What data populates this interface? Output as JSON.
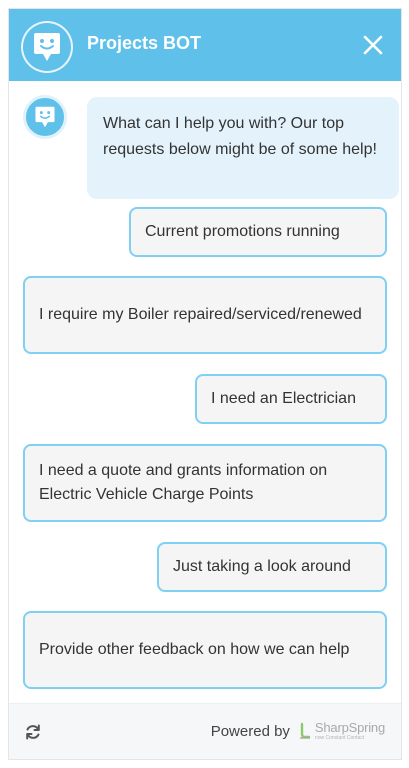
{
  "header": {
    "title": "Projects BOT",
    "brand_color": "#5fc0ea"
  },
  "chat": {
    "bot_message": "What can I help you with? Our top requests below might be of some help!"
  },
  "options": [
    {
      "label": "Current promotions running"
    },
    {
      "label": "I require my Boiler repaired/serviced/renewed"
    },
    {
      "label": "I need an Electrician"
    },
    {
      "label": "I need a quote and grants information on Electric Vehicle Charge Points"
    },
    {
      "label": "Just taking a look around"
    },
    {
      "label": "Provide other feedback on how we can help"
    }
  ],
  "footer": {
    "powered_by": "Powered by",
    "brand_name": "SharpSpring",
    "brand_sub": "now Constant Contact"
  },
  "icons": {
    "header_avatar": "bot-face-icon",
    "close": "close-icon",
    "refresh": "refresh-icon",
    "brand_logo": "sharpspring-logo-icon"
  },
  "colors": {
    "accent": "#5fc0ea",
    "bubble_bg": "#e4f3fb",
    "option_border": "#7fd0f2",
    "option_bg": "#f5f5f5"
  }
}
